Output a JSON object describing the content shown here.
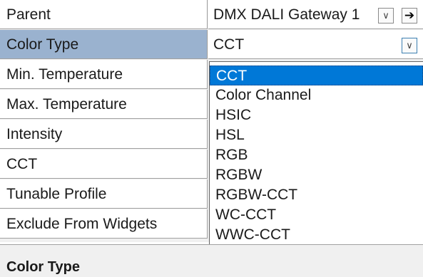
{
  "properties": [
    {
      "name": "Parent",
      "value": "DMX DALI Gateway 1"
    },
    {
      "name": "Color Type",
      "value": "CCT"
    },
    {
      "name": "Min. Temperature"
    },
    {
      "name": "Max. Temperature"
    },
    {
      "name": "Intensity"
    },
    {
      "name": "CCT"
    },
    {
      "name": "Tunable Profile"
    },
    {
      "name": "Exclude From Widgets"
    }
  ],
  "icons": {
    "dropdown": "chevron-down-icon",
    "navigate": "arrow-right-icon"
  },
  "glyphs": {
    "chevron": "∨",
    "arrow": "➔"
  },
  "dropdown": {
    "selected": "CCT",
    "options": [
      "CCT",
      "Color Channel",
      "HSIC",
      "HSL",
      "RGB",
      "RGBW",
      "RGBW-CCT",
      "WC-CCT",
      "WWC-CCT"
    ]
  },
  "description": {
    "title": "Color Type"
  },
  "colors": {
    "selected_row": "#9ab2cf",
    "highlight": "#0078d7"
  }
}
